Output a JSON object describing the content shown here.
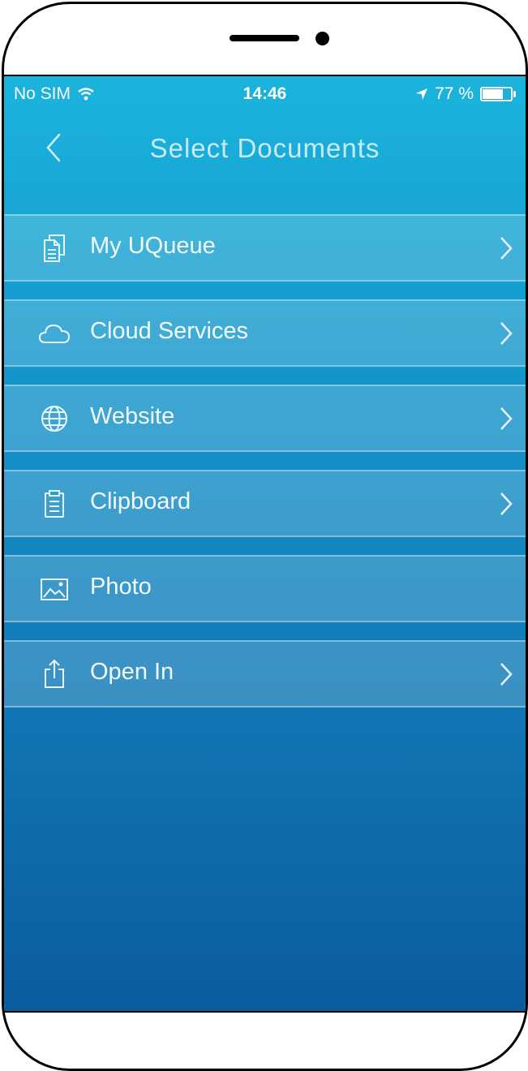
{
  "status_bar": {
    "carrier": "No SIM",
    "time": "14:46",
    "battery_text": "77 %",
    "battery_level": 0.77,
    "wifi_icon": "wifi-icon",
    "location_icon": "location-arrow-icon",
    "battery_icon": "battery-icon"
  },
  "nav": {
    "title": "Select Documents",
    "back_icon": "chevron-left-icon"
  },
  "menu": {
    "items": [
      {
        "label": "My UQueue",
        "icon": "documents-icon",
        "has_chevron": true
      },
      {
        "label": "Cloud Services",
        "icon": "cloud-icon",
        "has_chevron": true
      },
      {
        "label": "Website",
        "icon": "globe-icon",
        "has_chevron": true
      },
      {
        "label": "Clipboard",
        "icon": "clipboard-icon",
        "has_chevron": true
      },
      {
        "label": "Photo",
        "icon": "photo-icon",
        "has_chevron": false
      },
      {
        "label": "Open In",
        "icon": "share-icon",
        "has_chevron": true
      }
    ]
  },
  "colors": {
    "gradient_top": "#1bb4dd",
    "gradient_bottom": "#0c5c9c",
    "text": "#f2fbfe"
  }
}
